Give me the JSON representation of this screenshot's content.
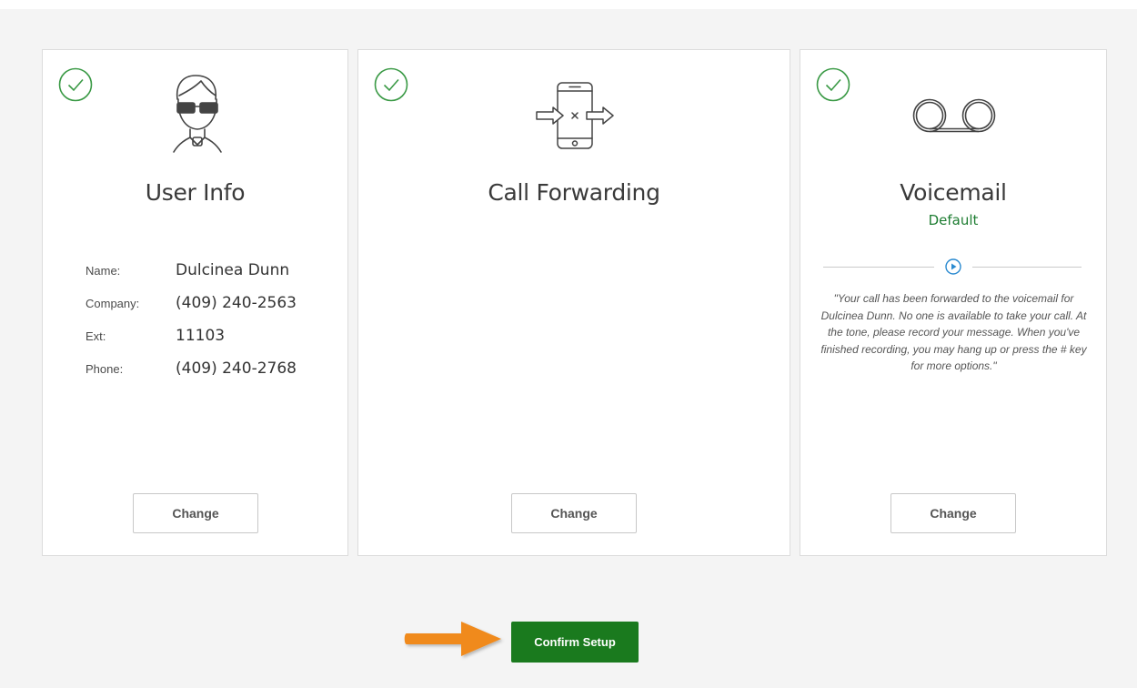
{
  "colors": {
    "accent_green": "#1a7a1e",
    "check_green": "#3b9a46",
    "play_blue": "#2a8ad0",
    "arrow_orange": "#f08a1c"
  },
  "cards": {
    "user_info": {
      "title": "User Info",
      "icon": "user-avatar-icon",
      "fields": [
        {
          "label": "Name:",
          "value": "Dulcinea Dunn"
        },
        {
          "label": "Company:",
          "value": "(409) 240-2563"
        },
        {
          "label": "Ext:",
          "value": "11103"
        },
        {
          "label": "Phone:",
          "value": "(409) 240-2768"
        }
      ],
      "button_label": "Change"
    },
    "call_forwarding": {
      "title": "Call Forwarding",
      "icon": "phone-forward-icon",
      "button_label": "Change"
    },
    "voicemail": {
      "title": "Voicemail",
      "icon": "voicemail-icon",
      "subtitle": "Default",
      "greeting": "\"Your call has been forwarded to the voicemail for Dulcinea Dunn. No one is available to take your call. At the tone, please record your message. When you've finished recording, you may hang up or press the # key for more options.\"",
      "button_label": "Change"
    }
  },
  "footer": {
    "confirm_label": "Confirm Setup"
  }
}
